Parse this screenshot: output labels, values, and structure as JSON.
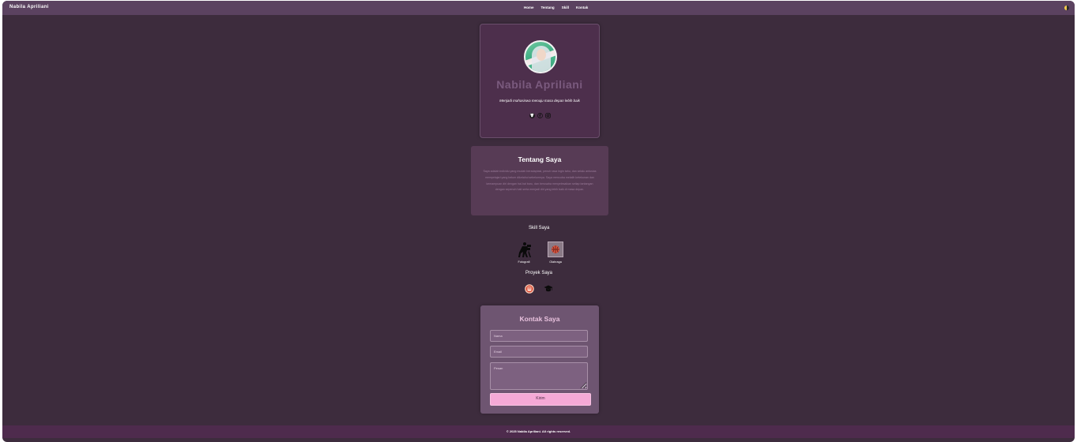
{
  "navbar": {
    "brand": "Nabila Apriliani",
    "links": [
      "Home",
      "Tentang",
      "Skill",
      "Kontak"
    ]
  },
  "profile": {
    "name": "Nabila Apriliani",
    "tagline": "Menjadi mahasiswa menuju masa depan lebih baik",
    "social_icons": [
      "github-icon",
      "facebook-icon",
      "instagram-icon"
    ]
  },
  "about": {
    "title": "Tentang Saya",
    "text": "Saya adalah individu yang mudah beradaptasi, penuh rasa ingin tahu, dan selalu antusias mempelajari yang belum diketahui sebelumnya. Saya mencoba melatih ketekunan dan kemampuan diri dengan hal-hal baru, dan berusaha menyelesaikan setiap tantangan dengan sepenuh hati serta menjadi diri yang lebih baik di masa depan."
  },
  "skills": {
    "title": "Skill Saya",
    "items": [
      {
        "label": "Fotografi",
        "icon": "camera-person-icon"
      },
      {
        "label": "Olahraga",
        "icon": "basketball-icon"
      }
    ]
  },
  "projects": {
    "title": "Proyek Saya",
    "icons": [
      "app-project-icon",
      "graduation-cap-icon"
    ]
  },
  "contact": {
    "title": "Kontak Saya",
    "name_placeholder": "Nama",
    "email_placeholder": "Email",
    "message_placeholder": "Pesan",
    "submit_label": "Kirim"
  },
  "footer": {
    "text": "© 2025 Nabila Apriliani. All rights reserved."
  },
  "colors": {
    "background": "#3d2c3d",
    "navbar": "#5b4260",
    "card": "#4d2f4c",
    "accent": "#f5a9d6"
  }
}
